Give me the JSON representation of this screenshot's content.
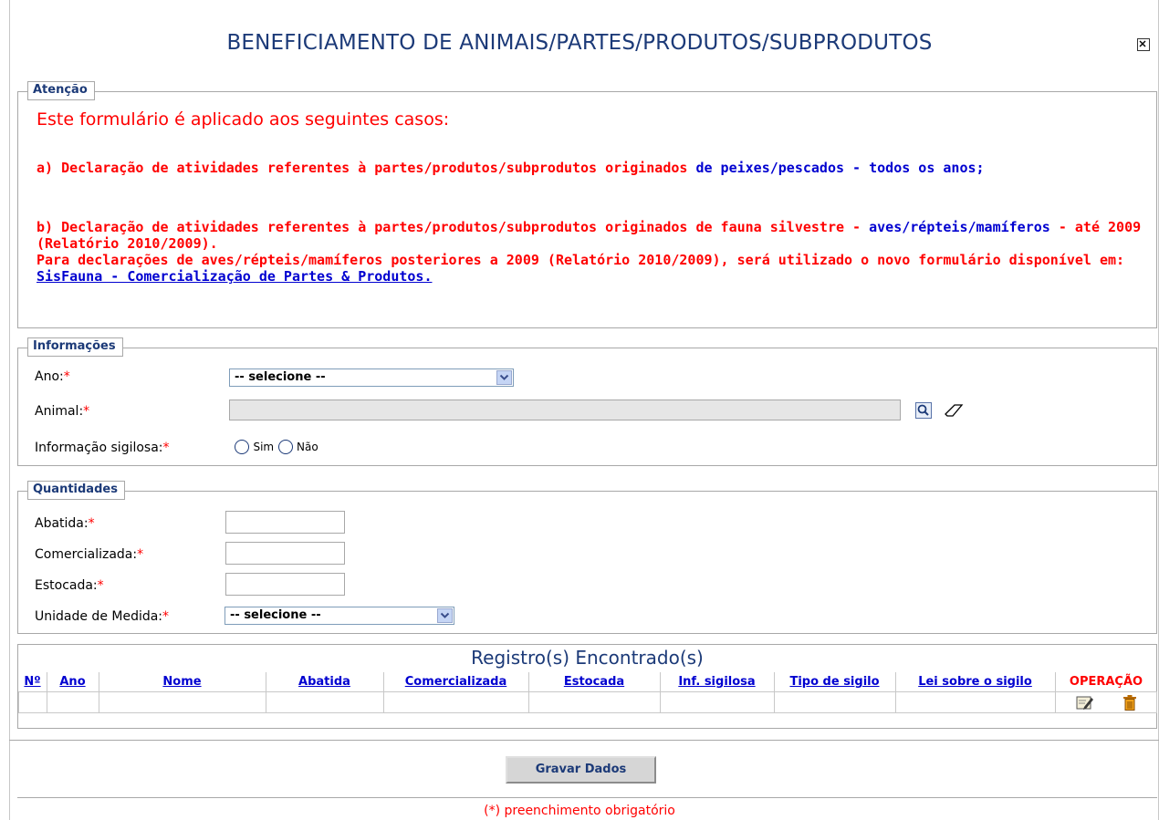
{
  "dialog": {
    "title": "BENEFICIAMENTO DE ANIMAIS/PARTES/PRODUTOS/SUBPRODUTOS",
    "close_label": "x"
  },
  "attention": {
    "legend": "Atenção",
    "heading": "Este formulário é aplicado aos seguintes casos:",
    "item_a_red": "a) Declaração de atividades referentes à partes/produtos/subprodutos originados",
    "item_a_blue": "de peixes/pescados - todos os anos;",
    "item_b_red": "b) Declaração de atividades referentes à partes/produtos/subprodutos originados de fauna silvestre -",
    "item_b_blue": "aves/répteis/mamíferos",
    "item_b_red2": "- até 2009 (Relatório 2010/2009).",
    "item_b_note": "Para declarações de aves/répteis/mamíferos posteriores a 2009 (Relatório 2010/2009), será utilizado o novo formulário disponível em:",
    "item_b_link": " SisFauna - Comercialização de Partes & Produtos."
  },
  "info": {
    "legend": "Informações",
    "ano_label": "Ano:",
    "ano_value": "-- selecione --",
    "animal_label": "Animal:",
    "sigilosa_label": "Informação sigilosa:",
    "sim_label": "Sim",
    "nao_label": "Não",
    "required_mark": "*"
  },
  "quant": {
    "legend": "Quantidades",
    "abatida_label": "Abatida:",
    "comercializada_label": "Comercializada:",
    "estocada_label": "Estocada:",
    "unidade_label": "Unidade de Medida:",
    "unidade_value": "-- selecione --"
  },
  "results": {
    "title": "Registro(s) Encontrado(s)",
    "columns": [
      "Nº",
      "Ano",
      "Nome",
      "Abatida",
      "Comercializada",
      "Estocada",
      "Inf. sigilosa",
      "Tipo de sigilo",
      "Lei sobre o sigilo",
      "OPERAÇÃO"
    ]
  },
  "actions": {
    "save_label": "Gravar Dados",
    "footnote": "(*) preenchimento obrigatório"
  },
  "icons": {
    "close": "close-icon",
    "search": "search-icon",
    "eraser": "eraser-icon",
    "edit": "edit-icon",
    "delete": "trash-icon",
    "dropdown": "chevron-down-icon"
  },
  "colors": {
    "title": "#1c3a78",
    "warning": "#ff0000",
    "link": "#0000d0"
  }
}
